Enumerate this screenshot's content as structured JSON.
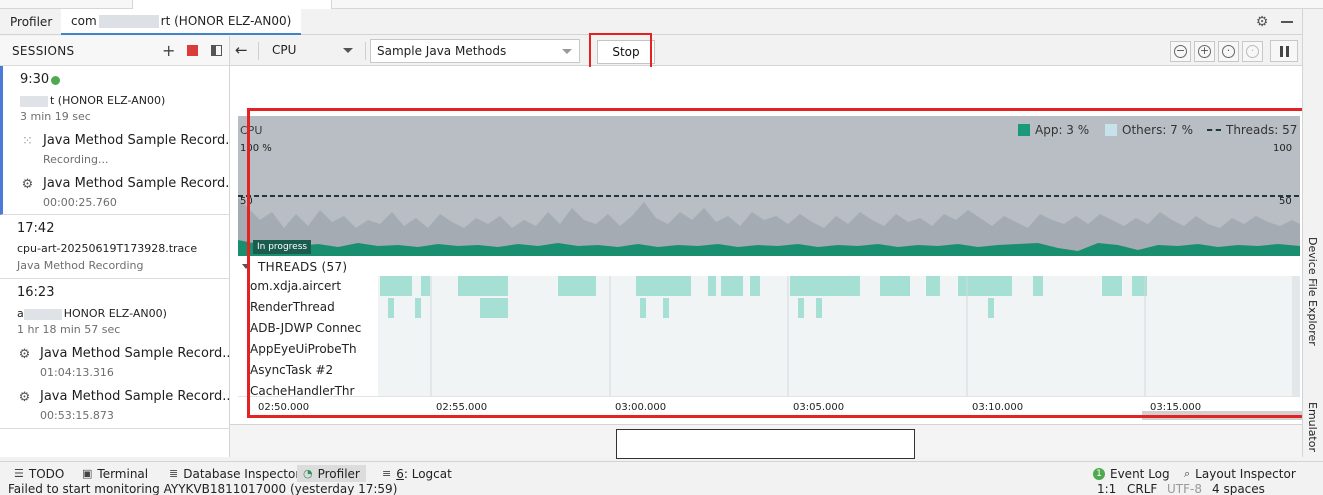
{
  "title_bar": {
    "tool_name": "Profiler",
    "tab_prefix": "com",
    "tab_middle": "rt",
    "tab_suffix": "(HONOR ELZ-AN00)"
  },
  "sessions": {
    "header": "SESSIONS",
    "items": [
      {
        "time": "9:30",
        "status_color": "#4faa4f",
        "device": "t (HONOR ELZ-AN00)",
        "duration": "3 min 19 sec",
        "recordings": [
          {
            "icon": "spinner-icon",
            "title": "Java Method Sample Record...",
            "sub": "Recording..."
          },
          {
            "icon": "gear-icon",
            "title": "Java Method Sample Record...",
            "sub": "00:00:25.760"
          }
        ]
      },
      {
        "time": "17:42",
        "file": "cpu-art-20250619T173928.trace",
        "type": "Java Method Recording"
      },
      {
        "time": "16:23",
        "device": "HONOR ELZ-AN00)",
        "device_prefix": "a",
        "duration": "1 hr 18 min 57 sec",
        "recordings": [
          {
            "icon": "gear-icon",
            "title": "Java Method Sample Record...",
            "sub": "01:04:13.316"
          },
          {
            "icon": "gear-icon",
            "title": "Java Method Sample Record...",
            "sub": "00:53:15.873"
          }
        ]
      }
    ]
  },
  "toolbar": {
    "monitor": "CPU",
    "config": "Sample Java Methods",
    "stop_label": "Stop"
  },
  "cpu": {
    "label": "CPU",
    "y_max_left": "100 %",
    "y_mid_left": "50",
    "y_max_right": "100",
    "y_mid_right": "50",
    "legend": {
      "app": "App: 3 %",
      "others": "Others: 7 %",
      "threads": "Threads: 57"
    },
    "colors": {
      "app": "#1a9a7a",
      "others": "#c6e2ea",
      "bg": "#b8bec4"
    },
    "status": "In progress"
  },
  "threads": {
    "header": "THREADS (57)",
    "names": [
      "om.xdja.aircert",
      "RenderThread",
      "ADB-JDWP Connec",
      "AppEyeUiProbeTh",
      "AsyncTask #2",
      "CacheHandlerThr"
    ]
  },
  "axis": {
    "labels": [
      "02:50.000",
      "02:55.000",
      "03:00.000",
      "03:05.000",
      "03:10.000",
      "03:15.000"
    ]
  },
  "right_rail": {
    "device_file_explorer": "Device File Explorer",
    "emulator": "Emulator"
  },
  "bottom_tools": {
    "todo": "TODO",
    "terminal": "Terminal",
    "database": "Database Inspector",
    "profiler": "Profiler",
    "logcat_num": "6",
    "logcat": "Logcat",
    "event_log_count": "1",
    "event_log": "Event Log",
    "layout_inspector": "Layout Inspector"
  },
  "status_bar": {
    "message": "Failed to start monitoring AYYKVB1811017000 (yesterday 17:59)",
    "position": "1:1",
    "line_sep": "CRLF",
    "encoding": "UTF-8",
    "indent": "4 spaces"
  }
}
